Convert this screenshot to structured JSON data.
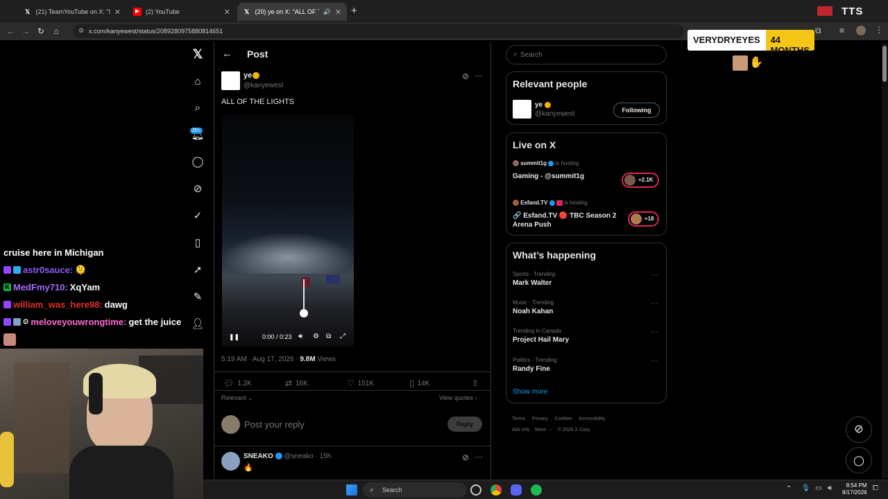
{
  "browser": {
    "tabs": [
      {
        "label": "(21) TeamYouTube on X: \"Startin",
        "icon": "x-logo"
      },
      {
        "label": "(2) YouTube",
        "icon": "youtube-logo"
      },
      {
        "label": "(20) ye on X: \"ALL OF THE L",
        "icon": "x-logo",
        "active": true
      }
    ],
    "url": "x.com/kanyewest/status/2089280975880814651",
    "overlay_text": "TTS"
  },
  "sub_badge": {
    "name": "VERYDRYEYES",
    "months": "44 MONTHS"
  },
  "chat": [
    {
      "user": "",
      "text": "cruise here in Michigan",
      "color": "#ffffff"
    },
    {
      "user": "astr0sauce:",
      "text": "🫠",
      "color": "#8a5cf6"
    },
    {
      "user": "MedFmy710:",
      "text": "XqYam",
      "color": "#7c5cff"
    },
    {
      "user": "william_was_here98:",
      "text": "dawg",
      "color": "#e0312b"
    },
    {
      "user": "meloveyouwrongtime:",
      "text": "get the juice",
      "color": "#ff6bd6"
    }
  ],
  "xnav": {
    "notif_badge": "20+"
  },
  "post": {
    "header": "Post",
    "author_name": "ye",
    "author_handle": "@kanyewest",
    "text": "ALL OF THE LIGHTS",
    "video_time": "0:00 / 0:23",
    "timestamp": "5:19 AM · Aug 17, 2026 ·",
    "views_count": "9.8M",
    "views_label": "Views",
    "replies": "1.2K",
    "reposts": "16K",
    "likes": "151K",
    "bookmarks": "14K",
    "sort_label": "Relevant",
    "view_quotes": "View quotes",
    "reply_placeholder": "Post your reply",
    "reply_button": "Reply"
  },
  "reply_post": {
    "name": "SNEAKO",
    "handle": "@sneako",
    "age": "· 15h",
    "text": "🔥"
  },
  "right": {
    "search_placeholder": "Search",
    "relevant_title": "Relevant people",
    "person_name": "ye",
    "person_handle": "@kanyewest",
    "following_label": "Following",
    "live_title": "Live on X",
    "live": [
      {
        "host": "summit1g",
        "hosting": "is hosting",
        "title": "Gaming - @summit1g",
        "count": "+2.1K"
      },
      {
        "host": "Esfand.TV",
        "hosting": "is hosting",
        "title": "🔗 Esfand.TV 🔴 TBC Season 2 Arena Push",
        "count": "+18"
      }
    ],
    "happening_title": "What’s happening",
    "trends": [
      {
        "context": "Sports · Trending",
        "name": "Mark Walter"
      },
      {
        "context": "Music · Trending",
        "name": "Noah Kahan"
      },
      {
        "context": "Trending in Canada",
        "name": "Project Hail Mary"
      },
      {
        "context": "Politics · Trending",
        "name": "Randy Fine"
      }
    ],
    "show_more": "Show more",
    "footer": [
      "Terms",
      "Privacy",
      "Cookies",
      "Accessibility",
      "Ads info",
      "More ···",
      "© 2026 X Corp."
    ]
  },
  "taskbar": {
    "search_label": "Search",
    "time": "8:54 PM",
    "date": "8/17/2026"
  },
  "colors": {
    "accent": "#1d9bf0",
    "verified": "#f4b400",
    "sub_yellow": "#f5c518"
  }
}
